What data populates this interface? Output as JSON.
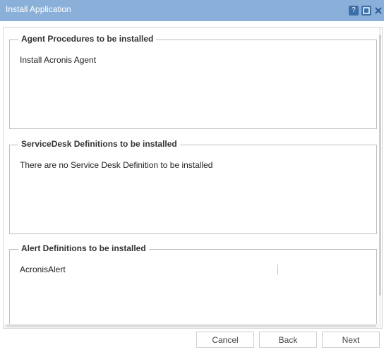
{
  "window": {
    "title": "Install Application",
    "buttons": {
      "help_icon": "?",
      "maximize_icon": "maximize",
      "close_icon": "close"
    }
  },
  "sections": [
    {
      "legend": "Agent Procedures to be installed",
      "text": "Install Acronis Agent"
    },
    {
      "legend": "ServiceDesk Definitions to be installed",
      "text": "There are no Service Desk Definition to be installed"
    },
    {
      "legend": "Alert Definitions to be installed",
      "text": "AcronisAlert"
    }
  ],
  "footer": {
    "cancel_label": "Cancel",
    "back_label": "Back",
    "next_label": "Next"
  },
  "colors": {
    "header": "#8ab0d9",
    "button_icon_bg": "#3c6fa7",
    "border": "#bdbdbd"
  }
}
